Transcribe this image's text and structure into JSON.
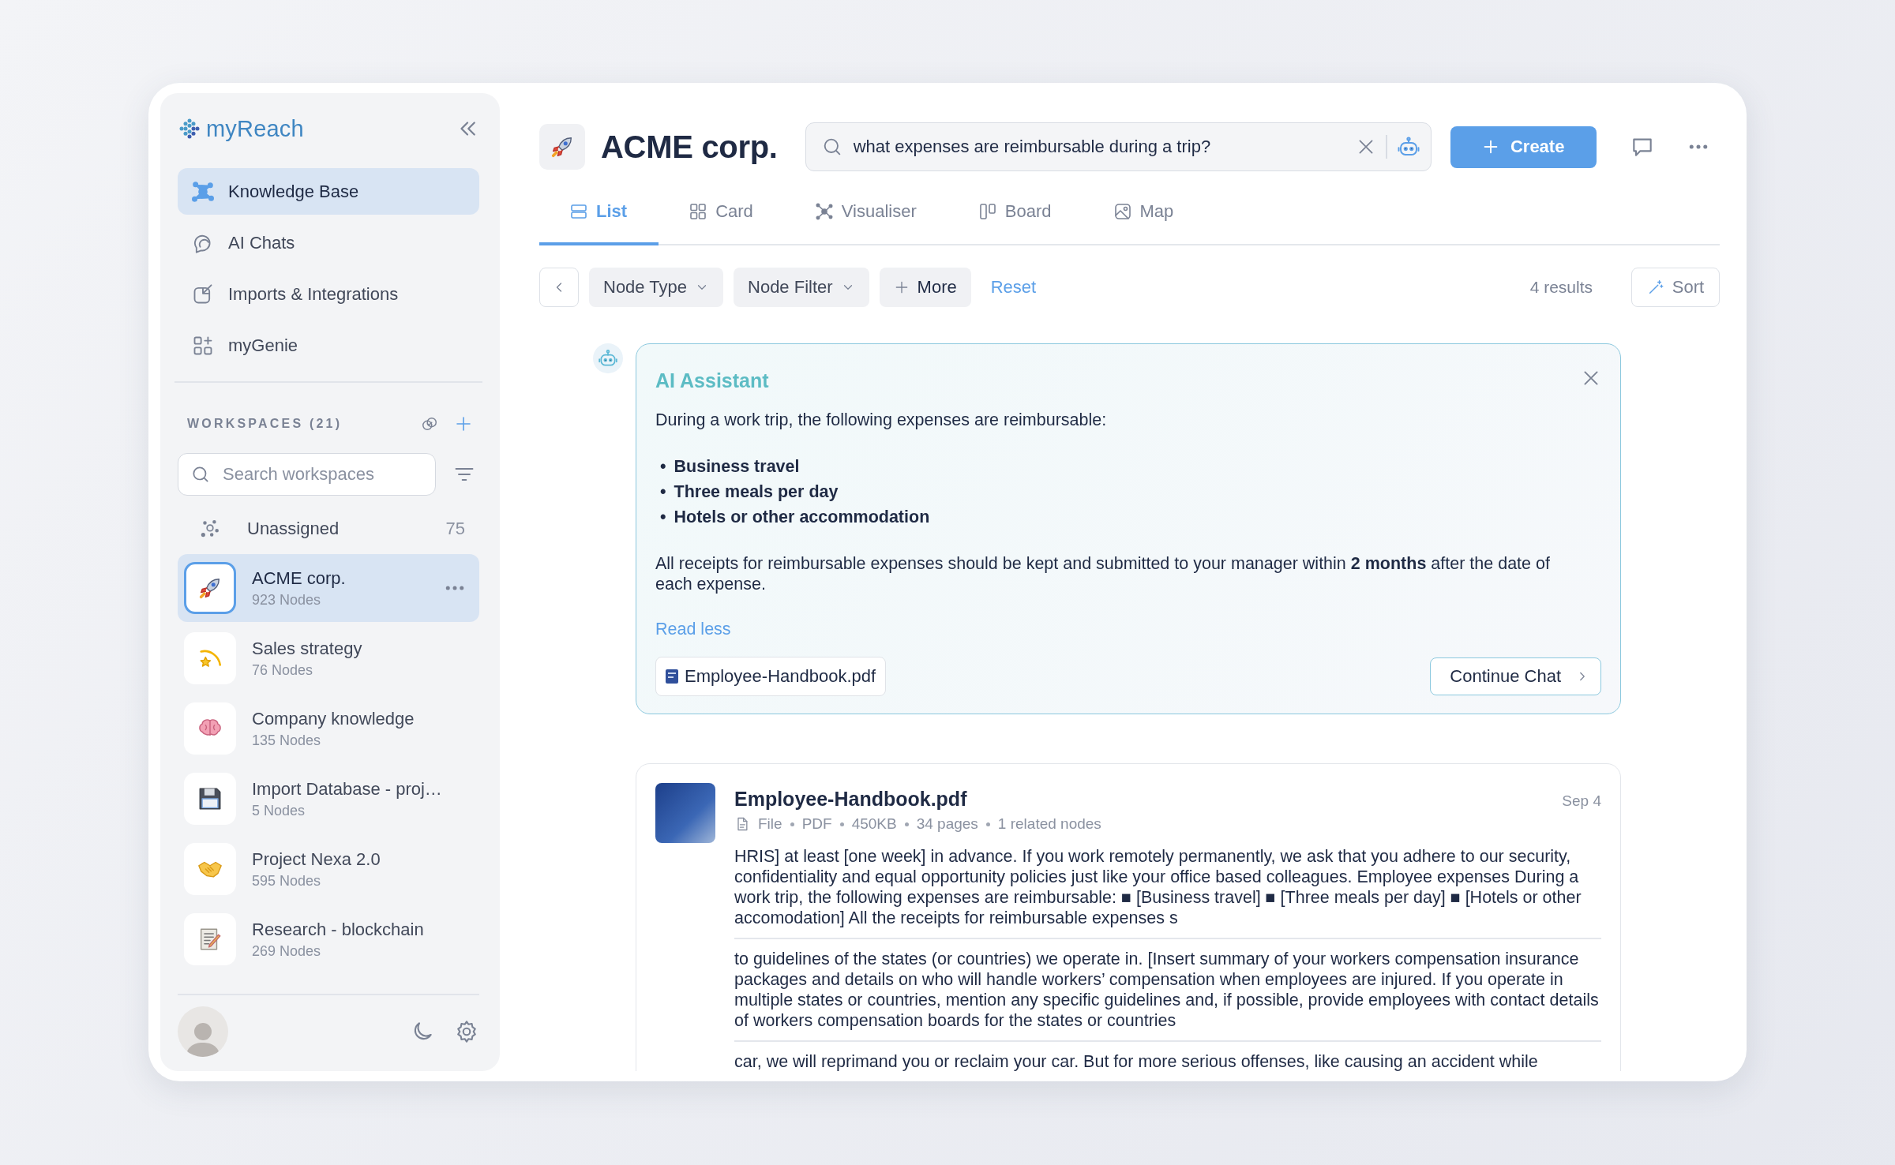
{
  "sidebar": {
    "logo": "myReach",
    "nav": [
      {
        "label": "Knowledge Base",
        "selected": true
      },
      {
        "label": "AI Chats",
        "selected": false
      },
      {
        "label": "Imports & Integrations",
        "selected": false
      },
      {
        "label": "myGenie",
        "selected": false
      }
    ],
    "workspaces_header": "WORKSPACES (21)",
    "search": {
      "placeholder": "Search workspaces"
    },
    "unassigned": {
      "label": "Unassigned",
      "count": "75"
    },
    "workspaces": [
      {
        "name": "ACME corp.",
        "nodes": "923 Nodes",
        "selected": true
      },
      {
        "name": "Sales strategy",
        "nodes": "76 Nodes",
        "selected": false
      },
      {
        "name": "Company knowledge",
        "nodes": "135 Nodes",
        "selected": false
      },
      {
        "name": "Import Database - proj…",
        "nodes": "5 Nodes",
        "selected": false
      },
      {
        "name": "Project Nexa 2.0",
        "nodes": "595 Nodes",
        "selected": false
      },
      {
        "name": "Research - blockchain",
        "nodes": "269 Nodes",
        "selected": false
      }
    ]
  },
  "header": {
    "title": "ACME corp.",
    "search": {
      "value": "what expenses are reimbursable during a trip?"
    },
    "create": "Create"
  },
  "tabs": [
    {
      "label": "List",
      "selected": true
    },
    {
      "label": "Card",
      "selected": false
    },
    {
      "label": "Visualiser",
      "selected": false
    },
    {
      "label": "Board",
      "selected": false
    },
    {
      "label": "Map",
      "selected": false
    }
  ],
  "filters": {
    "items": [
      {
        "label": "Node Type",
        "kind": "dropdown"
      },
      {
        "label": "Node Filter",
        "kind": "dropdown"
      },
      {
        "label": "More",
        "kind": "add"
      }
    ],
    "reset": "Reset",
    "results": "4 results",
    "sort": "Sort"
  },
  "assistant": {
    "title": "AI Assistant",
    "intro": "During a work trip, the following expenses are reimbursable:",
    "bullets": [
      {
        "marker": "•",
        "text": "Business travel"
      },
      {
        "marker": "•",
        "text": "Three meals per day"
      },
      {
        "marker": "•",
        "text": "Hotels or other accommodation"
      }
    ],
    "note": "All receipts for reimbursable expenses should be kept and submitted to your manager within **2 months** after the date of each expense.",
    "read_less": "Read less",
    "source": "Employee-Handbook.pdf",
    "continue": "Continue Chat"
  },
  "result": {
    "title": "Employee-Handbook.pdf",
    "date": "Sep 4",
    "meta": [
      "File",
      "PDF",
      "450KB",
      "34 pages",
      "1 related nodes"
    ],
    "snippets": [
      "HRIS] at least [one week] in advance. If you work remotely permanently, we ask that you adhere to our security, confidentiality and equal opportunity policies just like your office based colleagues. Employee expenses During a work trip, the following expenses are reimbursable: ■ [Business travel] ■ [Three meals per day] ■ [Hotels or other accomodation] All the receipts for reimbursable expenses s",
      "to guidelines of the states (or countries) we operate in. [Insert summary of your workers compensation insurance packages and details on who will handle workers’ compensation when employees are injured. If you operate in multiple states or countries, mention any specific guidelines and, if possible, provide employees with contact details of workers compensation boards for the states or countries",
      "car, we will reprimand you or reclaim your car. But for more serious offenses, like causing an accident while"
    ]
  }
}
